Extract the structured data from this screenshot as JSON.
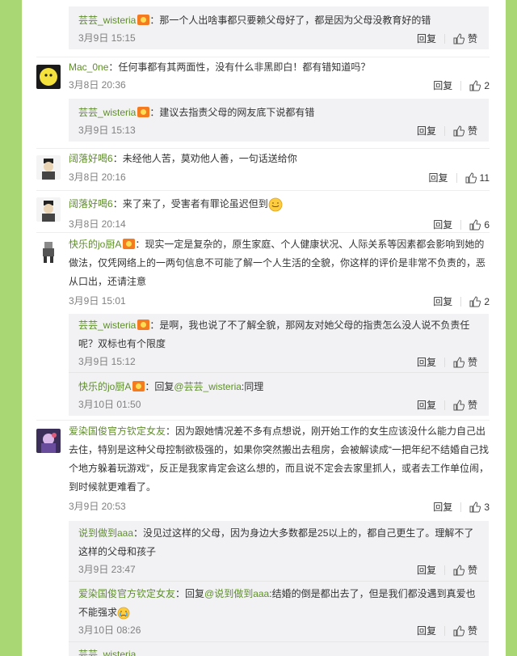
{
  "comments": [
    {
      "id": "c0",
      "replies": [
        {
          "user": "芸芸_wisteria",
          "text": "：那一个人出啥事都只要赖父母好了，都是因为父母没教育好的错",
          "time": "3月9日 15:15",
          "reply_label": "回复",
          "like_label": "赞"
        }
      ]
    },
    {
      "id": "c1",
      "user": "Mac_0ne",
      "avatar": "yellow-face",
      "text": "：任何事都有其两面性，没有什么非黑即白！都有错知道吗？",
      "time": "3月8日 20:36",
      "reply_label": "回复",
      "likes": "2",
      "replies": [
        {
          "user": "芸芸_wisteria",
          "text": "：建议去指责父母的网友底下说都有错",
          "time": "3月9日 15:13",
          "reply_label": "回复",
          "like_label": "赞"
        }
      ]
    },
    {
      "id": "c2",
      "user": "阔落好喝6",
      "avatar": "cartoon-man",
      "text": "：未经他人苦，莫劝他人善，一句话送给你",
      "time": "3月8日 20:16",
      "reply_label": "回复",
      "likes": "11"
    },
    {
      "id": "c3",
      "user": "阔落好喝6",
      "avatar": "cartoon-man",
      "text": "：来了来了，受害者有罪论虽迟但到",
      "time": "3月8日 20:14",
      "reply_label": "回复",
      "likes": "6"
    },
    {
      "id": "c4",
      "user": "快乐的jo厨A",
      "avatar": "pixel-character",
      "text_lines": [
        "：现实一定是复杂的，原生家庭、个人健康状况、人际关系等因素都会影响到她的",
        "做法，仅凭网络上的一两句信息不可能了解一个人生活的全貌，你这样的评价是非常不负责的，恶",
        "从口出，还请注意"
      ],
      "time": "3月9日 15:01",
      "reply_label": "回复",
      "likes": "2",
      "replies": [
        {
          "user": "芸芸_wisteria",
          "text_lines": [
            "：是啊，我也说了不了解全貌，那网友对她父母的指责怎么没人说不负责任",
            "呢？双标也有个限度"
          ],
          "time": "3月9日 15:12",
          "reply_label": "回复",
          "like_label": "赞"
        },
        {
          "user": "快乐的jo厨A",
          "prefix": "：回复",
          "mention": "@芸芸_wisteria",
          "text": ":同理",
          "time": "3月10日 01:50",
          "reply_label": "回复",
          "like_label": "赞"
        }
      ]
    },
    {
      "id": "c5",
      "user": "爱染国俊官方钦定女友",
      "avatar": "anime-girl",
      "text_lines": [
        "：因为跟她情况差不多有点想说，刚开始工作的女生应该没什么能力自己出",
        "去住，特别是这种父母控制欲极强的，如果你突然搬出去租房，会被解读成“一把年纪不结婚自己找",
        "个地方躲着玩游戏”，反正是我家肯定会这么想的，而且说不定会去家里抓人，或者去工作单位闹，",
        "到时候就更难看了。"
      ],
      "time": "3月9日 20:53",
      "reply_label": "回复",
      "likes": "3",
      "replies": [
        {
          "user": "说到做到aaa",
          "text_lines": [
            "：没见过这样的父母，因为身边大多数都是25以上的，都自己更生了。理解不了",
            "这样的父母和孩子"
          ],
          "time": "3月9日 23:47",
          "reply_label": "回复",
          "like_label": "赞"
        },
        {
          "user": "爱染国俊官方钦定女友",
          "prefix": "：回复",
          "mention": "@说到做到aaa",
          "text_lines": [
            ":结婚的倒是都出去了，但是我们都没遇到真爱也",
            "不能强求"
          ],
          "time": "3月10日 08:26",
          "reply_label": "回复",
          "like_label": "赞"
        },
        {
          "user": "芸芸_wisteria"
        }
      ]
    }
  ],
  "colors": {
    "background": "#a9d774",
    "username": "#5e8e29",
    "meta": "#808080",
    "reply_bg": "#f2f2f5"
  }
}
